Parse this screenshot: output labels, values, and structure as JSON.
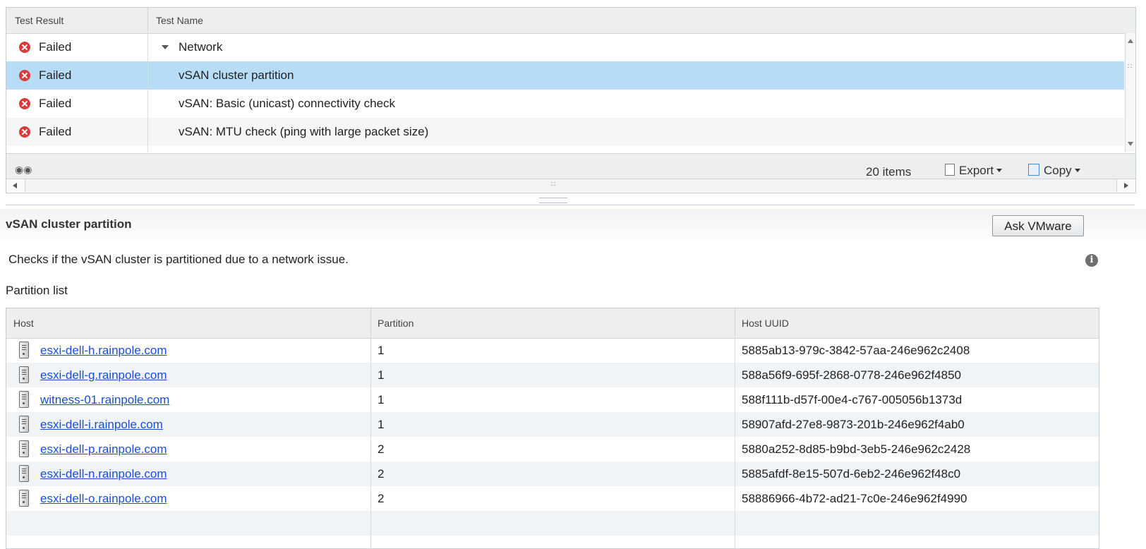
{
  "tests_grid": {
    "columns": {
      "result": "Test Result",
      "name": "Test Name"
    },
    "rows": [
      {
        "result": "Failed",
        "name": "Network",
        "expanded": true,
        "selected": false
      },
      {
        "result": "Failed",
        "name": "vSAN cluster partition",
        "selected": true
      },
      {
        "result": "Failed",
        "name": "vSAN: Basic (unicast) connectivity check",
        "selected": false
      },
      {
        "result": "Failed",
        "name": "vSAN: MTU check (ping with large packet size)",
        "selected": false
      }
    ],
    "footer": {
      "items_count": "20 items",
      "export_label": "Export",
      "copy_label": "Copy"
    }
  },
  "details": {
    "title": "vSAN cluster partition",
    "ask_button": "Ask VMware",
    "description": "Checks if the vSAN cluster is partitioned due to a network issue.",
    "list_label": "Partition list"
  },
  "partition_table": {
    "columns": {
      "host": "Host",
      "partition": "Partition",
      "uuid": "Host UUID"
    },
    "rows": [
      {
        "host": "esxi-dell-h.rainpole.com",
        "partition": "1",
        "uuid": "5885ab13-979c-3842-57aa-246e962c2408"
      },
      {
        "host": "esxi-dell-g.rainpole.com",
        "partition": "1",
        "uuid": "588a56f9-695f-2868-0778-246e962f4850"
      },
      {
        "host": "witness-01.rainpole.com",
        "partition": "1",
        "uuid": "588f111b-d57f-00e4-c767-005056b1373d"
      },
      {
        "host": "esxi-dell-i.rainpole.com",
        "partition": "1",
        "uuid": "58907afd-27e8-9873-201b-246e962f4ab0"
      },
      {
        "host": "esxi-dell-p.rainpole.com",
        "partition": "2",
        "uuid": "5880a252-8d85-b9bd-3eb5-246e962c2428"
      },
      {
        "host": "esxi-dell-n.rainpole.com",
        "partition": "2",
        "uuid": "5885afdf-8e15-507d-6eb2-246e962f48c0"
      },
      {
        "host": "esxi-dell-o.rainpole.com",
        "partition": "2",
        "uuid": "58886966-4b72-ad21-7c0e-246e962f4990"
      }
    ]
  },
  "icons": {
    "status": "failed-x-icon",
    "host": "server-icon",
    "info": "info-icon",
    "search": "binoculars-icon",
    "export": "document-icon",
    "copy": "copy-icon"
  },
  "colors": {
    "failed": "#d93a3a",
    "selected_row": "#b7dcf6",
    "link": "#1b4fd1"
  }
}
